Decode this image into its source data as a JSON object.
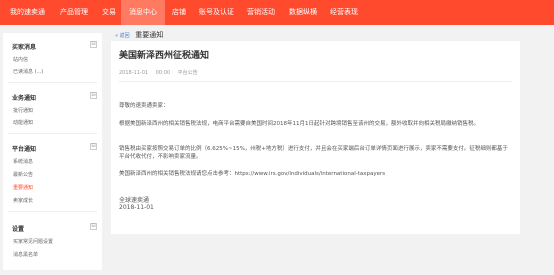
{
  "topnav": {
    "items": [
      {
        "label": "我的速卖通"
      },
      {
        "label": "产品管理"
      },
      {
        "label": "交易"
      },
      {
        "label": "消息中心"
      },
      {
        "label": "店铺"
      },
      {
        "label": "账号及认证"
      },
      {
        "label": "营销活动"
      },
      {
        "label": "数据纵横"
      },
      {
        "label": "经营表现"
      }
    ],
    "active_color": "#ff7a61",
    "bar_color": "#ff4a2e"
  },
  "sidebar": {
    "sections": [
      {
        "title": "买家消息",
        "toggle": "⊟",
        "items": [
          "站内信",
          "已读消息 (...)"
        ]
      },
      {
        "title": "业务通知",
        "toggle": "⊟",
        "items": [
          "批行通知",
          "动能通知"
        ]
      },
      {
        "title": "平台通知",
        "toggle": "⊟",
        "items": [
          "系统消息",
          "最新公告",
          "重要通知",
          "卖家成长"
        ]
      },
      {
        "title": "设置",
        "toggle": "⊟",
        "items": [
          "买家常见问题设置",
          "消息黑名单"
        ]
      }
    ],
    "active_item": "重要通知"
  },
  "breadcrumb": {
    "back": "« 返回",
    "title": "重要通知"
  },
  "notice": {
    "title": "美国新泽西州征税通知",
    "date": "2018-11-01",
    "time": "00:00",
    "source": "平台公告",
    "greeting": "尊敬的速卖通卖家：",
    "para1": "根据美国新泽西州的相关销售税法规，电商平台需要自美国时间2018年11月1日起针对跨境销售至该州的交易，额外收取并向相关税局缴纳销售税。",
    "para2": "销售税由买家按照交易订单的比例（6.625%~15%，州税+地方税）进行支付，并且会在买家端后台订单详情页面进行展示，卖家不需要支付。征税细则都基于平台代收代付，不影响卖家流量。",
    "para3": "美国新泽西州的相关销售税法规请您点击参考：https://www.irs.gov/individuals/international-taxpayers",
    "sign_org": "全球速卖通",
    "sign_date": "2018-11-01"
  }
}
